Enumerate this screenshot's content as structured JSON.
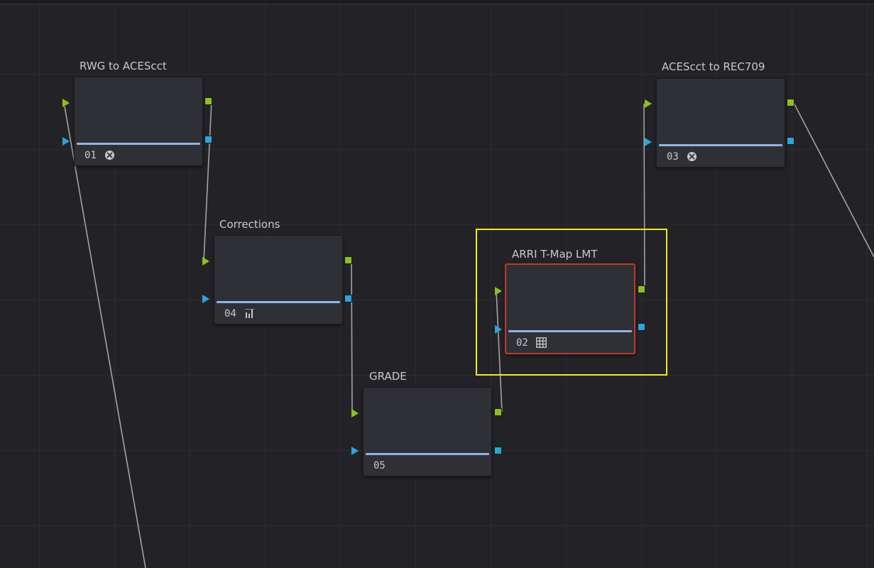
{
  "graph": {
    "nodes": [
      {
        "id": "n01",
        "title": "RWG to ACEScct",
        "number": "01",
        "icon": "aces-icon"
      },
      {
        "id": "n04",
        "title": "Corrections",
        "number": "04",
        "icon": "histogram-icon"
      },
      {
        "id": "n05",
        "title": "GRADE",
        "number": "05",
        "icon": ""
      },
      {
        "id": "n02",
        "title": "ARRI T-Map LMT",
        "number": "02",
        "icon": "lut-grid-icon",
        "selected": true
      },
      {
        "id": "n03",
        "title": "ACEScct to REC709",
        "number": "03",
        "icon": "aces-icon"
      }
    ]
  },
  "colors": {
    "background": "#232327",
    "rgb_port": "#8bc21a",
    "key_port": "#29a6e0",
    "node_bar": "#8fb5e6",
    "selection_box": "#f2ea1d",
    "selected_border": "#c0392b"
  }
}
